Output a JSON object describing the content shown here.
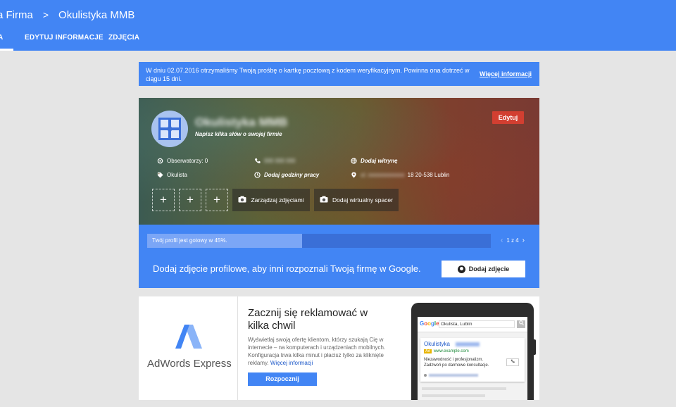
{
  "header": {
    "crumb_root": "a Firma",
    "crumb_sep": ">",
    "crumb_current": "Okulistyka MMB",
    "tabs": [
      {
        "label": "A",
        "active": true
      },
      {
        "label": "EDYTUJ INFORMACJE",
        "active": false
      },
      {
        "label": "ZDJĘCIA",
        "active": false
      }
    ]
  },
  "notice": {
    "text": "W dniu 02.07.2016 otrzymaliśmy Twoją prośbę o kartkę pocztową z kodem weryfikacyjnym. Powinna ona dotrzeć w ciągu 15 dni.",
    "link": "Więcej informacji"
  },
  "profile": {
    "name": "Okulistyka MMB",
    "tagline": "Napisz kilka słów o swojej firmie",
    "edit_label": "Edytuj",
    "followers": "Obserwatorzy: 0",
    "phone": "000 000 000",
    "website": "Dodaj witrynę",
    "category": "Okulista",
    "hours": "Dodaj godziny pracy",
    "address_hidden": "ul. xxxxxxxxxxxxx",
    "address_visible": "18 20-538 Lublin",
    "add_symbol": "+",
    "manage_photos": "Zarządzaj zdjęciami",
    "virtual_tour": "Dodaj wirtualny spacer"
  },
  "progress": {
    "label": "Twój profil jest gotowy w 45%.",
    "percent": 45,
    "pager": "1 z 4",
    "prev": "‹",
    "next": "›",
    "prompt": "Dodaj zdjęcie profilowe, aby inni rozpoznali Twoją firmę w Google.",
    "button": "Dodaj zdjęcie"
  },
  "ads": {
    "brand": "AdWords Express",
    "title": "Zacznij się reklamować w kilka chwil",
    "description": "Wyświetlaj swoją ofertę klientom, którzy szukają Cię w internecie – na komputerach i urządzeniach mobilnych. Konfiguracja trwa kilka minut i płacisz tylko za kliknięte reklamy.",
    "more": "Więcej informacji",
    "start": "Rozpocznij",
    "colors": {
      "logo_light": "#8ab4f8",
      "logo_dark": "#4285f4"
    },
    "phone": {
      "logo": "Google",
      "query": "Okulista, Lublin",
      "search_icon": "search-icon",
      "result_title": "Okulistyka",
      "ad_tag": "Ad",
      "url": "www.example.com",
      "desc": "Niezawodność i profesjonalizm. Zadzwoń po darmowe konsultacje.",
      "call_icon": "phone-icon"
    }
  }
}
